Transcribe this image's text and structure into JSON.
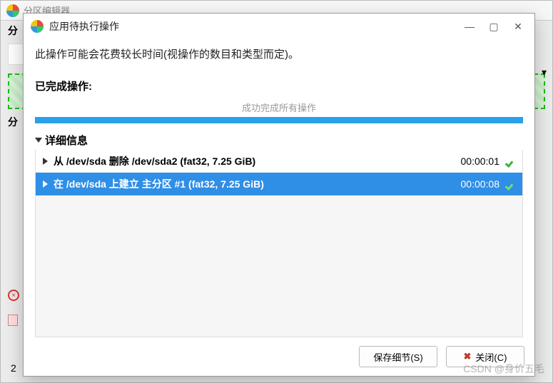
{
  "parent_window": {
    "title": "分区编辑器",
    "heading": "分",
    "heading2": "分",
    "bg_number": "2",
    "dropdown_caret": "▾"
  },
  "dialog": {
    "title": "应用待执行操作",
    "description": "此操作可能会花费较长时间(视操作的数目和类型而定)。",
    "completed_label": "已完成操作:",
    "status_line": "成功完成所有操作",
    "details_label": "详细信息",
    "operations": [
      {
        "desc": "从 /dev/sda 删除 /dev/sda2 (fat32, 7.25 GiB)",
        "time": "00:00:01",
        "selected": false
      },
      {
        "desc": "在 /dev/sda 上建立 主分区 #1 (fat32, 7.25 GiB)",
        "time": "00:00:08",
        "selected": true
      }
    ],
    "buttons": {
      "save": "保存细节(S)",
      "close": "关闭(C)"
    }
  },
  "watermark": "CSDN @身价五毛"
}
